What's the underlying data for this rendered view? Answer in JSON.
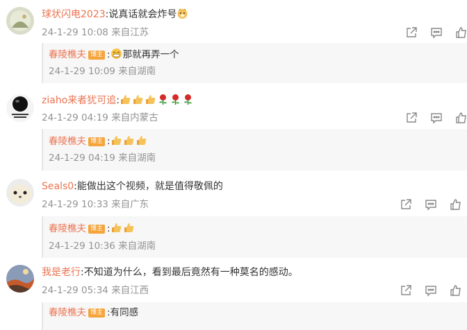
{
  "colors": {
    "username": "#eb7350",
    "meta": "#939393",
    "badge": "#f5a33b",
    "reply_bg": "#f7f7f7"
  },
  "comments": [
    {
      "user": "球状闪电2023",
      "text": "说真话就会炸号",
      "emoji_after_text": [
        "doge-face-emoji"
      ],
      "time": "24-1-29 10:08",
      "location": "来自江苏",
      "reply": {
        "user": "春陵樵夫",
        "badge": "博主",
        "text": "那就再弄一个",
        "emoji_before_text": [
          "grin-face-emoji"
        ],
        "time": "24-1-29 10:09",
        "location": "来自湖南"
      }
    },
    {
      "user": "ziaho来者犹可追",
      "text": "",
      "emoji_after_text": [
        "thumbs-up-emoji",
        "thumbs-up-emoji",
        "thumbs-up-emoji",
        "rose-emoji",
        "rose-emoji",
        "rose-emoji"
      ],
      "time": "24-1-29 04:19",
      "location": "来自内蒙古",
      "reply": {
        "user": "春陵樵夫",
        "badge": "博主",
        "text": "",
        "emoji_before_text": [
          "thumbs-up-emoji",
          "thumbs-up-emoji",
          "thumbs-up-emoji"
        ],
        "time": "24-1-29 04:19",
        "location": "来自湖南"
      }
    },
    {
      "user": "Seals0",
      "text": "能做出这个视频，就是值得敬佩的",
      "emoji_after_text": [],
      "time": "24-1-29 10:33",
      "location": "来自广东",
      "reply": {
        "user": "春陵樵夫",
        "badge": "博主",
        "text": "",
        "emoji_before_text": [
          "thumbs-up-emoji",
          "thumbs-up-emoji"
        ],
        "time": "24-1-29 10:36",
        "location": "来自湖南"
      }
    },
    {
      "user": "我是老行",
      "text": "不知道为什么，看到最后竟然有一种莫名的感动。",
      "emoji_after_text": [],
      "time": "24-1-29 05:34",
      "location": "来自江西",
      "reply": {
        "user": "春陵樵夫",
        "badge": "博主",
        "text": "有同感",
        "emoji_before_text": [],
        "time": "",
        "location": ""
      }
    }
  ]
}
